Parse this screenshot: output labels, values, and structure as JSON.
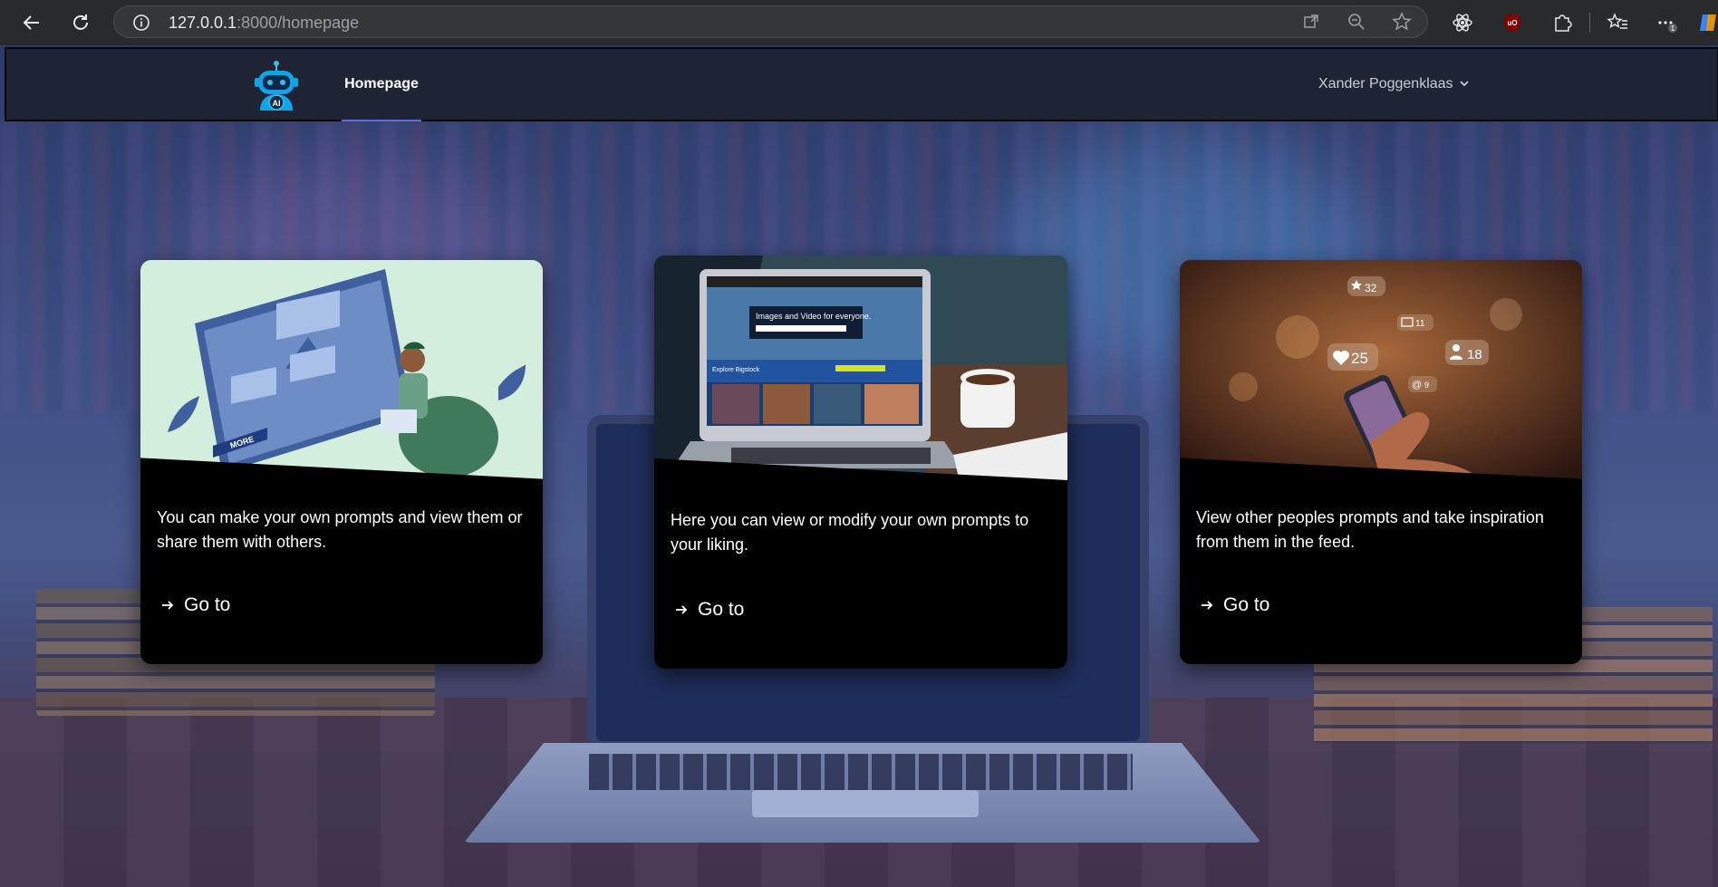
{
  "browser": {
    "url_host": "127.0.0.1",
    "url_rest": ":8000/homepage",
    "extension_badge": "1"
  },
  "navbar": {
    "logo_text": "AI",
    "home_label": "Homepage",
    "user_name": "Xander Poggenklaas",
    "accent_color": "#6366f1"
  },
  "cards": [
    {
      "description": "You can make your own prompts and view them or share them with others.",
      "link_label": "Go to",
      "image_button_label": "MORE"
    },
    {
      "description": "Here you can view or modify your own prompts to your liking.",
      "link_label": "Go to",
      "image_headline": "Images and Video for everyone.",
      "image_sub": "Explore Bigstock"
    },
    {
      "description": "View other peoples prompts and take inspiration from them in the feed.",
      "link_label": "Go to",
      "badges": {
        "stars": "32",
        "mail": "11",
        "likes": "25",
        "users": "18",
        "mentions": "9"
      }
    }
  ]
}
